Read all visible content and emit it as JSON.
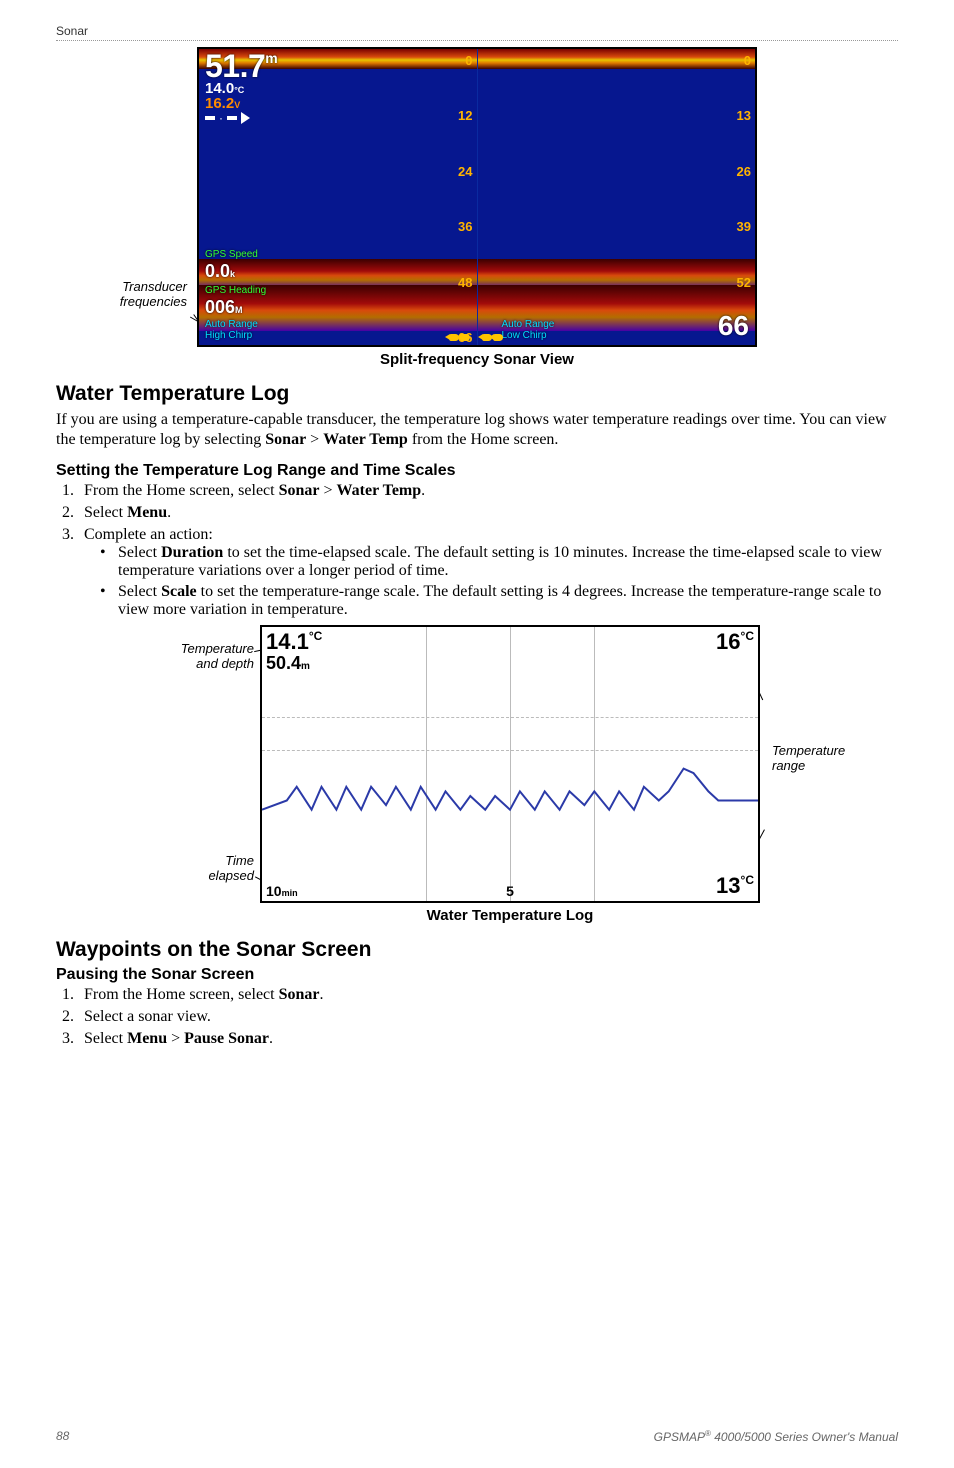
{
  "chapter": "Sonar",
  "sonar": {
    "caption": "Split-frequency Sonar View",
    "transducer_label_l1": "Transducer",
    "transducer_label_l2": "frequencies",
    "depth_value": "51.7",
    "depth_unit": "m",
    "temp_value": "14.0",
    "temp_unit": "°C",
    "volt_value": "16.2",
    "volt_unit": "V",
    "gps_speed_label": "GPS Speed",
    "gps_speed_value": "0.0",
    "gps_speed_unit": "k",
    "gps_heading_label": "GPS Heading",
    "gps_heading_value": "006",
    "gps_heading_unit": "M",
    "left_l1": "Auto Range",
    "left_l2": "High Chirp",
    "right_l1": "Auto Range",
    "right_l2": "Low Chirp",
    "left_scale": [
      "0",
      "12",
      "24",
      "36",
      "48",
      "66"
    ],
    "right_scale": [
      "0",
      "13",
      "26",
      "39",
      "52",
      "66"
    ],
    "bignum": "66"
  },
  "wt": {
    "heading": "Water Temperature Log",
    "para": "If you are using a temperature-capable transducer, the temperature log shows water temperature readings over time. You can view the temperature log by selecting ",
    "para_b1": "Sonar",
    "para_sep": " > ",
    "para_b2": "Water Temp",
    "para_tail": " from the Home screen.",
    "sub": "Setting the Temperature Log Range and Time Scales",
    "step1_a": "From the Home screen, select ",
    "step1_b1": "Sonar",
    "step1_sep": " > ",
    "step1_b2": "Water Temp",
    "step1_tail": ".",
    "step2_a": "Select ",
    "step2_b": "Menu",
    "step2_tail": ".",
    "step3": "Complete an action:",
    "bul1_a": "Select ",
    "bul1_b": "Duration",
    "bul1_c": " to set the time-elapsed scale. The default setting is 10 minutes. Increase the time-elapsed scale to view temperature variations over a longer period of time.",
    "bul2_a": "Select ",
    "bul2_b": "Scale",
    "bul2_c": " to set the temperature-range scale. The default setting is 4 degrees. Increase the temperature-range scale to view more variation in temperature."
  },
  "chart_data": {
    "type": "line",
    "title": "Water Temperature Log",
    "xlabel": "Time elapsed (min)",
    "ylabel": "Temperature (°C)",
    "ylim": [
      13,
      16
    ],
    "x_range_minutes": [
      10,
      0
    ],
    "current_temp_c": 14.1,
    "current_depth_m": 50.4,
    "series": [
      {
        "name": "Water Temperature",
        "x_min_ago": [
          10.0,
          9.5,
          9.3,
          9.0,
          8.8,
          8.5,
          8.3,
          8.0,
          7.8,
          7.5,
          7.3,
          7.0,
          6.8,
          6.5,
          6.3,
          6.0,
          5.8,
          5.5,
          5.3,
          5.0,
          4.8,
          4.5,
          4.3,
          4.0,
          3.8,
          3.5,
          3.3,
          3.0,
          2.8,
          2.5,
          2.3,
          2.0,
          1.8,
          1.5,
          1.3,
          1.0,
          0.8,
          0.5,
          0.3,
          0.0
        ],
        "y_temp_c": [
          14.0,
          14.1,
          14.25,
          14.0,
          14.25,
          14.0,
          14.25,
          14.0,
          14.25,
          14.05,
          14.25,
          14.0,
          14.25,
          14.0,
          14.2,
          14.0,
          14.15,
          14.0,
          14.15,
          14.0,
          14.2,
          14.0,
          14.2,
          14.0,
          14.2,
          14.05,
          14.2,
          14.0,
          14.2,
          14.0,
          14.25,
          14.1,
          14.2,
          14.45,
          14.4,
          14.2,
          14.1,
          14.1,
          14.1,
          14.1
        ]
      }
    ],
    "scale_labels": {
      "top_left": "14.1°C",
      "depth": "50.4m",
      "top_right": "16°C",
      "bottom_right": "13°C",
      "bottom_left": "10min",
      "bottom_mid": "5"
    }
  },
  "tc": {
    "caption": "Water Temperature Log",
    "cl_td_l1": "Temperature",
    "cl_td_l2": "and depth",
    "cl_time_l1": "Time",
    "cl_time_l2": "elapsed",
    "cl_range_l1": "Temperature",
    "cl_range_l2": "range",
    "tl_val": "14.1",
    "tl_unit": "°C",
    "depth_val": "50.4",
    "depth_unit": "m",
    "tr_val": "16",
    "tr_unit": "°C",
    "br_val": "13",
    "br_unit": "°C",
    "bl_val": "10",
    "bl_unit": "min",
    "bm_val": "5"
  },
  "wp": {
    "heading": "Waypoints on the Sonar Screen",
    "sub": "Pausing the Sonar Screen",
    "s1_a": "From the Home screen, select ",
    "s1_b": "Sonar",
    "s1_tail": ".",
    "s2": "Select a sonar view.",
    "s3_a": "Select ",
    "s3_b1": "Menu",
    "s3_sep": " > ",
    "s3_b2": "Pause Sonar",
    "s3_tail": "."
  },
  "footer": {
    "page": "88",
    "manual": "GPSMAP® 4000/5000 Series Owner's Manual"
  }
}
